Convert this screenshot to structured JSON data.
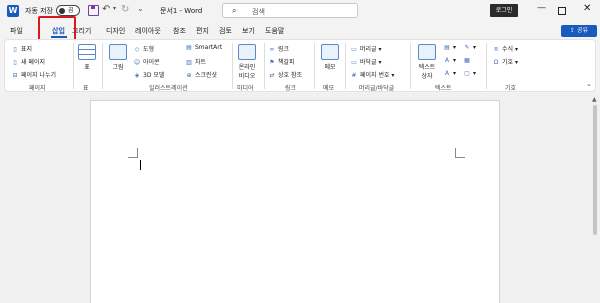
{
  "titlebar": {
    "autosave_label": "자동 저장",
    "autosave_state": "끔",
    "document_name": "문서1 - Word",
    "search_placeholder": "검색",
    "login_label": "로그인"
  },
  "tabs": [
    {
      "label": "파일"
    },
    {
      "label": "삽입",
      "active": true
    },
    {
      "label": "그리기"
    },
    {
      "label": "디자인"
    },
    {
      "label": "레이아웃"
    },
    {
      "label": "참조"
    },
    {
      "label": "편지"
    },
    {
      "label": "검토"
    },
    {
      "label": "보기"
    },
    {
      "label": "도움말"
    }
  ],
  "share_label": "공유",
  "ribbon": {
    "pages": {
      "items": [
        "표지",
        "새 페이지",
        "페이지 나누기"
      ],
      "label": "페이지"
    },
    "table": {
      "item": "표",
      "label": "표"
    },
    "illustrations": {
      "picture": "그림",
      "items": [
        "도형",
        "아이콘",
        "3D 모델",
        "SmartArt",
        "차트",
        "스크린샷"
      ],
      "label": "일러스트레이션"
    },
    "media": {
      "item_line1": "온라인",
      "item_line2": "비디오",
      "label": "미디어"
    },
    "links": {
      "items": [
        "링크",
        "책갈피",
        "상호 참조"
      ],
      "label": "링크"
    },
    "comments": {
      "item": "메모",
      "label": "메모"
    },
    "header_footer": {
      "items": [
        "머리글",
        "바닥글",
        "페이지 번호"
      ],
      "label": "머리글/바닥글"
    },
    "text": {
      "item_line1": "텍스트",
      "item_line2": "상자",
      "label": "텍스트"
    },
    "symbols": {
      "items": [
        "수식",
        "기호"
      ],
      "label": "기호"
    }
  },
  "colors": {
    "accent": "#185abd",
    "highlight": "#d9191f"
  }
}
